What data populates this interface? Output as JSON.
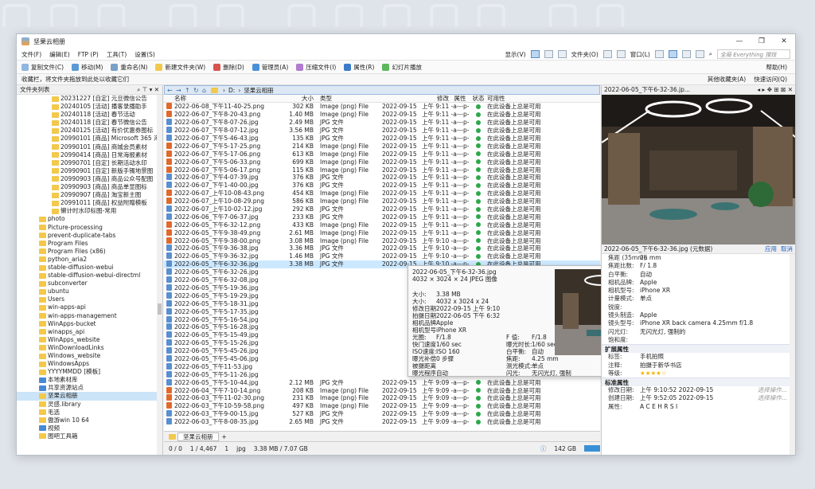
{
  "title": "坚果云相册",
  "menu": [
    "文件(F)",
    "编辑(E)",
    "FTP (P)",
    "工具(T)",
    "设置(S)"
  ],
  "menu_right": {
    "display": "显示(V)",
    "folder": "文件夹(O)",
    "window": "窗口(L)",
    "search": "全局 Everything 搜找",
    "help": "帮助(H)"
  },
  "toolbar": [
    "复制文件(C)",
    "移动(M)",
    "重命名(N)",
    "新建文件夹(W)",
    "删除(D)",
    "管理员(A)",
    "压缩文件(I)",
    "属性(R)",
    "幻灯片播放"
  ],
  "favbar": {
    "hint": "收藏栏，将文件夹拖放到此处以收藏它们",
    "other": "其他收藏夹(A)",
    "quick": "快速访问(Q)"
  },
  "tree": {
    "header": "文件夹列表",
    "items": [
      "20231227 [自定] 元旦微信公告",
      "20240105 [活动] 播客录播助手",
      "20240118 [活动] 春节活动",
      "20240118 [自定] 春节微信公告",
      "20240125 [活动] 有价优惠券图标",
      "20990101 [商品] Microsoft 365 海报",
      "20990101 [商品] 商城会员素材",
      "20990414 [商品] 日常海报素材",
      "20990701 [自定] 长期活动水印",
      "20990901 [自定] 新版手镯地景图",
      "20990903 [商品] 商品公众号配图",
      "20990903 [商品] 商品单显图标",
      "20990907 [商品] 淘宝新主图",
      "20991011 [商品] 权益附赠模板",
      "懒计时水印标图-常用",
      "photo",
      "Picture-processing",
      "prevent-duplicate-tabs",
      "Program Files",
      "Program Files (x86)",
      "python_aria2",
      "stable-diffusion-webui",
      "stable-diffusion-webui-directml",
      "subconverter",
      "ubuntu",
      "Users",
      "win-apps-api",
      "win-apps-management",
      "WinApps-bucket",
      "winapps_api",
      "WinApps_website",
      "WinDownloadLinks",
      "Windows_website",
      "WindowsApps",
      "YYYYMMDD [模板]",
      "本地素材库",
      "共享资源站点",
      "坚果云相册",
      "灵感.library",
      "毛选",
      "傲游win 10 64",
      "视频",
      "图吧工具箱"
    ]
  },
  "path": {
    "drive": "D:",
    "folder": "坚果云相册"
  },
  "columns": {
    "name": "名称",
    "size": "大小",
    "type": "类型",
    "mod": "修改",
    "attr": "属性",
    "status": "状态",
    "avail": "可用性"
  },
  "files": [
    [
      "2022-06-08_下午11-40-25.png",
      "302 KB",
      "Image (png) File",
      "2022-09-15",
      "上午 9:11",
      "-a---p-",
      "在此设备上总是可用"
    ],
    [
      "2022-06-07_下午8-20-43.png",
      "1.40 MB",
      "Image (png) File",
      "2022-09-15",
      "上午 9:11",
      "-a---p-",
      "在此设备上总是可用"
    ],
    [
      "2022-06-07_下午8-07-26.jpg",
      "2.49 MB",
      "JPG 文件",
      "2022-09-15",
      "上午 9:11",
      "-a---p-",
      "在此设备上总是可用"
    ],
    [
      "2022-06-07_下午8-07-12.jpg",
      "3.56 MB",
      "JPG 文件",
      "2022-09-15",
      "上午 9:11",
      "-a---p-",
      "在此设备上总是可用"
    ],
    [
      "2022-06-07_下午5-46-43.jpg",
      "135 KB",
      "JPG 文件",
      "2022-09-15",
      "上午 9:11",
      "-a---p-",
      "在此设备上总是可用"
    ],
    [
      "2022-06-07_下午5-17-25.png",
      "214 KB",
      "Image (png) File",
      "2022-09-15",
      "上午 9:11",
      "-a---p-",
      "在此设备上总是可用"
    ],
    [
      "2022-06-07_下午5-17-06.png",
      "613 KB",
      "Image (png) File",
      "2022-09-15",
      "上午 9:11",
      "-a---p-",
      "在此设备上总是可用"
    ],
    [
      "2022-06-07_下午5-06-33.png",
      "699 KB",
      "Image (png) File",
      "2022-09-15",
      "上午 9:11",
      "-a---p-",
      "在此设备上总是可用"
    ],
    [
      "2022-06-07_下午5-06-17.png",
      "115 KB",
      "Image (png) File",
      "2022-09-15",
      "上午 9:11",
      "-a---p-",
      "在此设备上总是可用"
    ],
    [
      "2022-06-07_下午4-07-39.jpg",
      "376 KB",
      "JPG 文件",
      "2022-09-15",
      "上午 9:11",
      "-a---p-",
      "在此设备上总是可用"
    ],
    [
      "2022-06-07_下午1-40-00.jpg",
      "376 KB",
      "JPG 文件",
      "2022-09-15",
      "上午 9:11",
      "-a---p-",
      "在此设备上总是可用"
    ],
    [
      "2022-06-07_上午10-08-43.png",
      "454 KB",
      "Image (png) File",
      "2022-09-15",
      "上午 9:11",
      "-a---p-",
      "在此设备上总是可用"
    ],
    [
      "2022-06-07_上午10-08-29.png",
      "586 KB",
      "Image (png) File",
      "2022-09-15",
      "上午 9:11",
      "-a---p-",
      "在此设备上总是可用"
    ],
    [
      "2022-06-07_上午10-02-12.jpg",
      "292 KB",
      "JPG 文件",
      "2022-09-15",
      "上午 9:11",
      "-a---p-",
      "在此设备上总是可用"
    ],
    [
      "2022-06-06_下午7-06-37.jpg",
      "233 KB",
      "JPG 文件",
      "2022-09-15",
      "上午 9:11",
      "-a---p-",
      "在此设备上总是可用"
    ],
    [
      "2022-06-05_下午6-32-12.png",
      "433 KB",
      "Image (png) File",
      "2022-09-15",
      "上午 9:11",
      "-a---p-",
      "在此设备上总是可用"
    ],
    [
      "2022-06-05_下午9-38-49.png",
      "2.61 MB",
      "Image (png) File",
      "2022-09-15",
      "上午 9:11",
      "-a---p-",
      "在此设备上总是可用"
    ],
    [
      "2022-06-05_下午9-38-00.png",
      "3.08 MB",
      "Image (png) File",
      "2022-09-15",
      "上午 9:10",
      "-a---p-",
      "在此设备上总是可用"
    ],
    [
      "2022-06-05_下午9-36-38.jpg",
      "3.36 MB",
      "JPG 文件",
      "2022-09-15",
      "上午 9:10",
      "-a---p-",
      "在此设备上总是可用"
    ],
    [
      "2022-06-05_下午9-36-32.jpg",
      "1.46 MB",
      "JPG 文件",
      "2022-09-15",
      "上午 9:10",
      "-a---p-",
      "在此设备上总是可用"
    ],
    [
      "2022-06-05_下午6-32-36.jpg",
      "3.38 MB",
      "JPG 文件",
      "2022-09-15",
      "上午 9:10",
      "-a---p-",
      "在此设备上总是可用"
    ],
    [
      "2022-06-05_下午6-32-26.jpg",
      "",
      "",
      "",
      "",
      "",
      ""
    ],
    [
      "2022-06-05_下午6-32-08.jpg",
      "",
      "",
      "",
      "",
      "",
      ""
    ],
    [
      "2022-06-05_下午5-19-36.jpg",
      "",
      "",
      "",
      "",
      "",
      ""
    ],
    [
      "2022-06-05_下午5-19-29.jpg",
      "",
      "",
      "",
      "",
      "",
      ""
    ],
    [
      "2022-06-05_下午5-18-31.jpg",
      "",
      "",
      "",
      "",
      "",
      ""
    ],
    [
      "2022-06-05_下午5-17-35.jpg",
      "",
      "",
      "",
      "",
      "",
      ""
    ],
    [
      "2022-06-05_下午5-16-54.jpg",
      "",
      "",
      "",
      "",
      "",
      ""
    ],
    [
      "2022-06-05_下午5-16-28.jpg",
      "",
      "",
      "",
      "",
      "",
      ""
    ],
    [
      "2022-06-05_下午5-15-49.jpg",
      "",
      "",
      "",
      "",
      "",
      ""
    ],
    [
      "2022-06-05_下午5-15-26.jpg",
      "",
      "",
      "",
      "",
      "",
      ""
    ],
    [
      "2022-06-05_下午5-45-26.jpg",
      "",
      "",
      "",
      "",
      "",
      ""
    ],
    [
      "2022-06-05_下午5-45-06.jpg",
      "",
      "",
      "",
      "",
      "",
      ""
    ],
    [
      "2022-06-05_下午11-53.jpg",
      "",
      "",
      "",
      "",
      "",
      ""
    ],
    [
      "2022-06-05_下午5-11-26.jpg",
      "",
      "",
      "",
      "",
      "",
      ""
    ],
    [
      "2022-06-05_下午5-10-44.jpg",
      "2.12 MB",
      "JPG 文件",
      "2022-09-15",
      "上午 9:09",
      "-a---p-",
      "在此设备上总是可用"
    ],
    [
      "2022-06-04_下午7-10-14.png",
      "208 KB",
      "Image (png) File",
      "2022-09-15",
      "上午 9:09",
      "-a---p-",
      "在此设备上总是可用"
    ],
    [
      "2022-06-03_下午11-02-30.png",
      "231 KB",
      "Image (png) File",
      "2022-09-15",
      "上午 9:09",
      "-a---p-",
      "在此设备上总是可用"
    ],
    [
      "2022-06-03_下午10-59-58.png",
      "497 KB",
      "Image (png) File",
      "2022-09-15",
      "上午 9:09",
      "-a---p-",
      "在此设备上总是可用"
    ],
    [
      "2022-06-03_下午9-00-15.jpg",
      "527 KB",
      "JPG 文件",
      "2022-09-15",
      "上午 9:09",
      "-a---p-",
      "在此设备上总是可用"
    ],
    [
      "2022-06-03_下午8-08-35.jpg",
      "2.65 MB",
      "JPG 文件",
      "2022-09-15",
      "上午 9:09",
      "-a---p-",
      "在此设备上总是可用"
    ]
  ],
  "tooltip": {
    "name": "2022-06-05_下午6-32-36.jpg",
    "dims": "4032 × 3024 × 24 JPEG 图像",
    "fields": [
      [
        "大小:",
        "3.38 MB",
        "",
        ""
      ],
      [
        "大小:",
        "4032 x 3024 x 24",
        "",
        ""
      ],
      [
        "修改日期:",
        "2022-09-15 上午 9:10",
        "",
        ""
      ],
      [
        "拍摄日期:",
        "2022-06-05 下午 6:32",
        "",
        ""
      ],
      [
        "相机品牌:",
        "Apple",
        "",
        ""
      ],
      [
        "相机型号:",
        "iPhone XR",
        "",
        ""
      ],
      [
        "光圈:",
        "F/1.8",
        "F 值:",
        "F/1.8"
      ],
      [
        "快门速度:",
        "1/60 sec",
        "曝光时长:",
        "1/60 sec"
      ],
      [
        "ISO速度:",
        "ISO 160",
        "白平衡:",
        "自动"
      ],
      [
        "曝光补偿:",
        "0 步骤",
        "焦距:",
        "4.25 mm"
      ],
      [
        "被摄距离:",
        "",
        "测光模式:",
        "单点"
      ],
      [
        "曝光程序:",
        "自动",
        "闪光:",
        "无闪光灯, 强制的"
      ]
    ]
  },
  "tabs": [
    "坚果云相册"
  ],
  "status": {
    "sel": "0 / 0",
    "count": "1 / 4,467",
    "num": "1",
    "ext": "jpg",
    "size": "3.38 MB / 7.07 GB",
    "free": "142 GB"
  },
  "preview": {
    "header": "2022-06-05_下午6-32-36.jp...",
    "meta_header": "2022-06-05_下午6-32-36.jpg (元数据)",
    "apply": "应用",
    "cancel": "取消"
  },
  "props": [
    [
      "焦距 (35mm):",
      "26    mm"
    ],
    [
      "焦距比数:",
      "F/ 1.8"
    ],
    [
      "白平衡:",
      "自动"
    ],
    [
      "相机品牌:",
      "Apple"
    ],
    [
      "相机型号:",
      "iPhone XR"
    ],
    [
      "计量模式:",
      "单点"
    ],
    [
      "锐度:",
      ""
    ],
    [
      "镜头制造:",
      "Apple"
    ],
    [
      "镜头型号:",
      "iPhone XR back camera 4.25mm f/1.8"
    ],
    [
      "闪光灯:",
      "无闪光灯, 强制的"
    ],
    [
      "饱和度:",
      ""
    ]
  ],
  "ext_group": "扩展属性",
  "ext": [
    [
      "标签:",
      "手机拍照"
    ],
    [
      "注释:",
      "拍摄于新华书店"
    ],
    [
      "等级:",
      "★★★★☆"
    ]
  ],
  "std_group": "标准属性",
  "std": [
    [
      "修改日期:",
      "上午  9:10:52    2022-09-15",
      "选择操作..."
    ],
    [
      "创建日期:",
      "上午  9:52:05    2022-09-15",
      "选择操作..."
    ],
    [
      "属性:",
      "A  C  E  H  R  S  I",
      ""
    ]
  ]
}
